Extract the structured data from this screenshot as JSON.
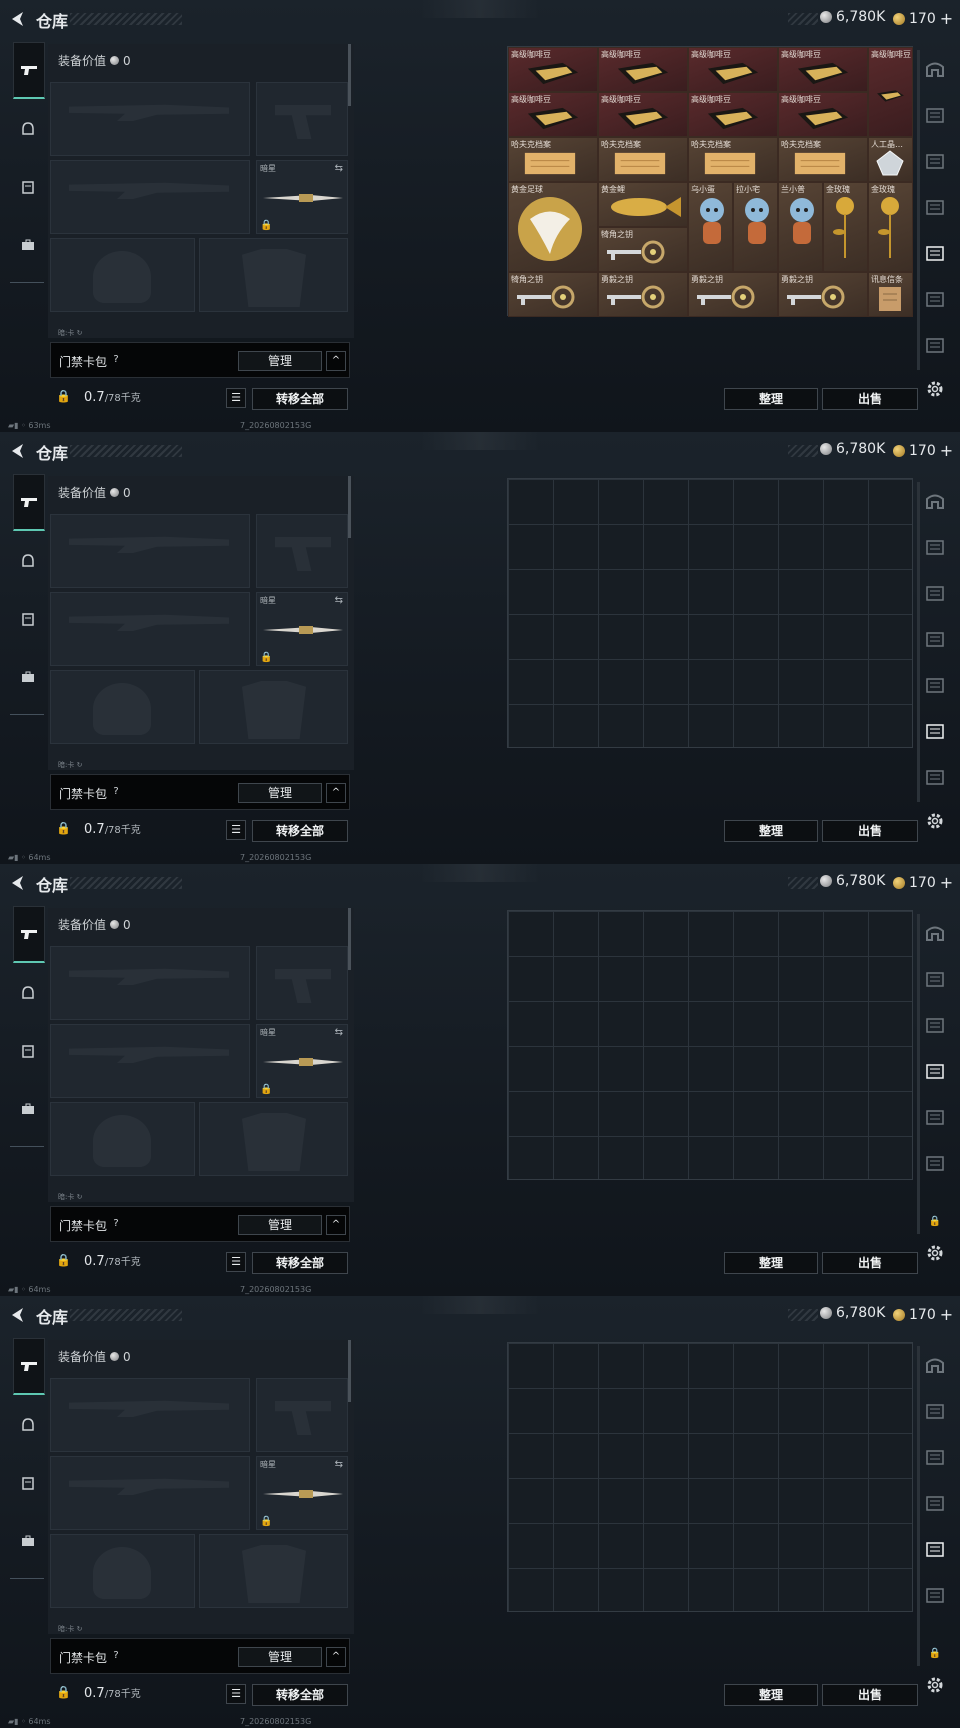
{
  "title": "仓库",
  "currency": {
    "silver": "6,780K",
    "gold": "170",
    "gold_plus": "+"
  },
  "equipment": {
    "value_label": "装备价值",
    "value": "0",
    "melee_label": "暗星",
    "kit_label": "暗:卡  ↻"
  },
  "card_bag": {
    "label": "门禁卡包",
    "help": "?",
    "manage": "管理",
    "toggle": "^"
  },
  "weight": {
    "current": "0.7",
    "max": "/78千克"
  },
  "buttons": {
    "transfer_all": "转移全部",
    "sort": "整理",
    "sell": "出售"
  },
  "status": {
    "latencies": [
      "63ms",
      "64ms",
      "64ms",
      "64ms"
    ],
    "build": "7_20260802153G"
  },
  "items": [
    {
      "label": "高级咖啡豆",
      "icon": "coffee-bag"
    },
    {
      "label": "高级咖啡豆",
      "icon": "coffee-bag"
    },
    {
      "label": "高级咖啡豆",
      "icon": "coffee-bag"
    },
    {
      "label": "高级咖啡豆",
      "icon": "coffee-bag"
    },
    {
      "label": "高级咖啡豆",
      "icon": "coffee-bag"
    },
    {
      "label": "高级咖啡豆",
      "icon": "coffee-bag"
    },
    {
      "label": "高级咖啡豆",
      "icon": "coffee-bag"
    },
    {
      "label": "高级咖啡豆",
      "icon": "coffee-bag"
    },
    {
      "label": "高级咖啡豆",
      "icon": "coffee-bag"
    },
    {
      "label": "哈夫克档案",
      "icon": "file"
    },
    {
      "label": "哈夫克档案",
      "icon": "file"
    },
    {
      "label": "哈夫克档案",
      "icon": "file"
    },
    {
      "label": "哈夫克档案",
      "icon": "file"
    },
    {
      "label": "人工晶…",
      "icon": "crystal"
    },
    {
      "label": "黄金足球",
      "icon": "gold-ball"
    },
    {
      "label": "黄金鲤",
      "icon": "gold-fish"
    },
    {
      "label": "犄角之钥",
      "icon": "key"
    },
    {
      "label": "乌小蛋",
      "icon": "figure"
    },
    {
      "label": "拉小宅",
      "icon": "figure"
    },
    {
      "label": "兰小普",
      "icon": "figure"
    },
    {
      "label": "金玫瑰",
      "icon": "gold-rose"
    },
    {
      "label": "金玫瑰",
      "icon": "gold-rose"
    },
    {
      "label": "犄角之钥",
      "icon": "key"
    },
    {
      "label": "勇毅之钥",
      "icon": "key"
    },
    {
      "label": "勇毅之钥",
      "icon": "key"
    },
    {
      "label": "勇毅之钥",
      "icon": "key"
    },
    {
      "label": "讯息信条",
      "icon": "paper"
    }
  ],
  "colors": {
    "accent": "#5ec8b2",
    "item_red": "#5a2a2c",
    "item_brown": "#574435"
  }
}
